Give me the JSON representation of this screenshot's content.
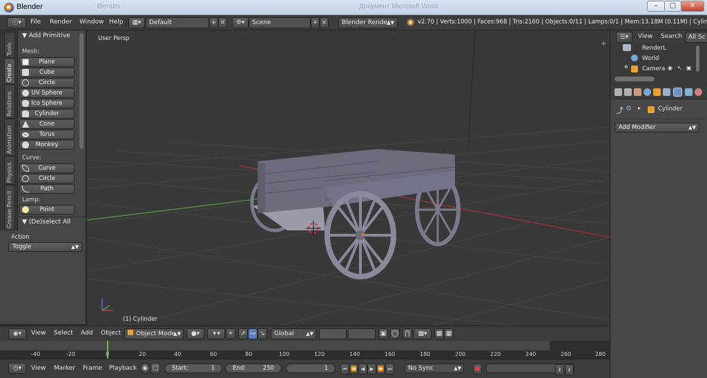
{
  "window": {
    "title": "Blender",
    "ghost_left": "Blender",
    "ghost_right": "Документ Microsoft Word"
  },
  "info_header": {
    "menus": [
      "File",
      "Render",
      "Window",
      "Help"
    ],
    "layout": "Default",
    "scene": "Scene",
    "engine": "Blender Render",
    "stats": "v2.70 | Verts:1000 | Faces:968 | Tris:2160 | Objects:0/11 | Lamps:0/1 | Mem:13.18M (0.11M) | Cylinder"
  },
  "tool_tabs": [
    "Tools",
    "Create",
    "Relations",
    "Animation",
    "Physics",
    "Grease Pencil"
  ],
  "toolshelf": {
    "panel_title": "Add Primitive",
    "mesh_label": "Mesh:",
    "mesh_items": [
      "Plane",
      "Cube",
      "Circle",
      "UV Sphere",
      "Ico Sphere",
      "Cylinder",
      "Cone",
      "Torus",
      "Monkey"
    ],
    "curve_label": "Curve:",
    "curve_items": [
      "Curve",
      "Circle",
      "Path"
    ],
    "lamp_label": "Lamp:",
    "lamp_items": [
      "Point"
    ],
    "operator_title": "(De)select All",
    "action_label": "Action",
    "action_value": "Toggle"
  },
  "viewport": {
    "view_name": "User Persp",
    "object_label": "(1) Cylinder"
  },
  "view3d_header": {
    "menus": [
      "View",
      "Select",
      "Add",
      "Object"
    ],
    "mode": "Object Mode",
    "orientation": "Global"
  },
  "timeline": {
    "ticks": [
      "-40",
      "-20",
      "0",
      "20",
      "40",
      "60",
      "80",
      "100",
      "120",
      "140",
      "160",
      "180",
      "200",
      "220",
      "240",
      "260",
      "280"
    ],
    "menus": [
      "View",
      "Marker",
      "Frame",
      "Playback"
    ],
    "start_label": "Start:",
    "start_value": "1",
    "end_label": "End:",
    "end_value": "250",
    "current_frame": "1",
    "sync": "No Sync"
  },
  "outliner": {
    "menus": [
      "View",
      "Search"
    ],
    "filter": "All Sc",
    "rows": [
      "RenderL",
      "World",
      "Camera"
    ]
  },
  "properties": {
    "object_name": "Cylinder",
    "add_modifier": "Add Modifier"
  },
  "colors": {
    "accent_blue": "#5680c2",
    "x_axis": "#a83232",
    "y_axis": "#5aa03c",
    "wagon": "#7a7a8c"
  }
}
